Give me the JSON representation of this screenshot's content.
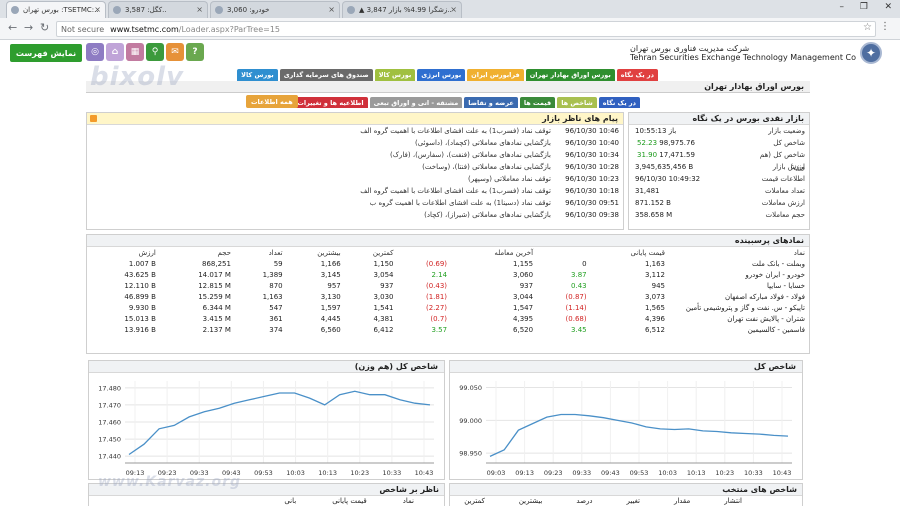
{
  "browser": {
    "tabs": [
      {
        "title": "بورس تهران :TSETMC:..",
        "active": true
      },
      {
        "title": "3,587 :کگل..",
        "active": false
      },
      {
        "title": "3,060 :خودرو",
        "active": false
      },
      {
        "title": "▲ 3,847 زشگرا 4.99% بازار..",
        "active": false
      }
    ],
    "url_secure": "Not secure",
    "url_host": "www.tsetmc.com",
    "url_path": "/Loader.aspx?ParTree=15"
  },
  "header": {
    "brand_fa": "شرکت مدیریت فناوری بورس تهران",
    "brand_en": "Tehran Securities Exchange Technology Management Co",
    "show_list": "نمایش فهرست",
    "tool_icons": [
      {
        "name": "help-icon",
        "glyph": "?",
        "color": "#6aa84f"
      },
      {
        "name": "message-icon",
        "glyph": "✉",
        "color": "#e69138"
      },
      {
        "name": "search-icon",
        "glyph": "⚲",
        "color": "#3c9a3c"
      },
      {
        "name": "calendar-icon",
        "glyph": "▦",
        "color": "#c27ba0"
      },
      {
        "name": "home-icon",
        "glyph": "⌂",
        "color": "#c0a4d8"
      },
      {
        "name": "compass-icon",
        "glyph": "◎",
        "color": "#8e7cc3"
      }
    ]
  },
  "mainnav": [
    {
      "label": "در یک نگاه",
      "color": "#e04040"
    },
    {
      "label": "بورس اوراق بهادار تهران",
      "color": "#2f8f2f"
    },
    {
      "label": "فرابورس ایران",
      "color": "#f0b030"
    },
    {
      "label": "بورس انرژی",
      "color": "#2f6fd0"
    },
    {
      "label": "بورس کالا",
      "color": "#a0c040"
    },
    {
      "label": "صندوق های سرمایه گذاری",
      "color": "#7a7a7a"
    },
    {
      "label": "بورس کالا",
      "color": "#2f8fd0"
    }
  ],
  "titlebar": "بورس اوراق بهادار تهران",
  "subnav": [
    {
      "label": "در یک نگاه",
      "color": "#3060c0"
    },
    {
      "label": "شاخص ها",
      "color": "#a8c050"
    },
    {
      "label": "قیمت ها",
      "color": "#3a8a3a"
    },
    {
      "label": "عرضه و تقاضا",
      "color": "#3a6ab0"
    },
    {
      "label": "مشتقه - اتی و اوراق تبعی",
      "color": "#9a9a9a"
    },
    {
      "label": "اطلاعیه ها و تغییرات",
      "color": "#d0303a"
    }
  ],
  "allinfo": "همه اطلاعات",
  "market": {
    "title": "بازار نقدی بورس در یک نگاه",
    "rows": [
      {
        "k": "وضعیت بازار",
        "v": "باز",
        "time": "10:55:13",
        "chg": ""
      },
      {
        "k": "شاخص کل",
        "v": "98,975.76",
        "chg": "52.23"
      },
      {
        "k": "شاخص کل (هم وزن)",
        "v": "17,471.59",
        "chg": "31.90"
      },
      {
        "k": "ارزش بازار",
        "v": "3,945,635,456 B",
        "chg": ""
      },
      {
        "k": "اطلاعات قیمت",
        "v": "96/10/30 10:49:32",
        "chg": ""
      },
      {
        "k": "تعداد معاملات",
        "v": "31,481",
        "chg": ""
      },
      {
        "k": "ارزش معاملات",
        "v": "871.152 B",
        "chg": ""
      },
      {
        "k": "حجم معاملات",
        "v": "358.658 M",
        "chg": ""
      }
    ]
  },
  "messages": {
    "title": "پیام های ناظر بازار",
    "rows": [
      {
        "d": "96/10/30 10:46",
        "t": "توقف نماد (فسرب1) به علت افشای اطلاعات با اهمیت گروه الف"
      },
      {
        "d": "96/10/30 10:40",
        "t": "بازگشایی نمادهای معاملاتی (کچماد)، (داسوئی)"
      },
      {
        "d": "96/10/30 10:34",
        "t": "بازگشایی نمادهای معاملاتی (فنفت)، (سفارس)، (فارک)"
      },
      {
        "d": "96/10/30 10:28",
        "t": "بازگشایی نمادهای معاملاتی (فنتا)، (وساخت)"
      },
      {
        "d": "96/10/30 10:23",
        "t": "توقف نماد معاملاتی (وسپهر)"
      },
      {
        "d": "96/10/30 10:18",
        "t": "توقف نماد (فسرب1) به علت افشای اطلاعات با اهمیت گروه الف"
      },
      {
        "d": "96/10/30 09:51",
        "t": "توقف نماد (دسینا1) به علت افشای اطلاعات با اهمیت گروه ب"
      },
      {
        "d": "96/10/30 09:38",
        "t": "بازگشایی نمادهای معاملاتی (شیراز)، (کچاد)"
      }
    ]
  },
  "influential": {
    "title": "نمادهای پرسبینده",
    "headers": [
      "نماد",
      "قیمت پایانی",
      "",
      "آخرین معامله",
      "",
      "کمترین",
      "بیشترین",
      "تعداد",
      "حجم",
      "ارزش"
    ],
    "rows": [
      {
        "name": "وبملت - بانک ملت",
        "close": "1,163",
        "close_chg": "0",
        "close_chg_cls": "",
        "last": "1,155",
        "last_chg": "(0.69)",
        "last_chg_cls": "neg",
        "low": "1,150",
        "high": "1,166",
        "count": "59",
        "vol": "868,251",
        "value": "1.007 B"
      },
      {
        "name": "خودرو - ایران خودرو",
        "close": "3,112",
        "close_chg": "3.87",
        "close_chg_cls": "pos",
        "last": "3,060",
        "last_chg": "2.14",
        "last_chg_cls": "pos",
        "low": "3,054",
        "high": "3,145",
        "count": "1,389",
        "vol": "14.017 M",
        "value": "43.625 B"
      },
      {
        "name": "خسایا - سایپا",
        "close": "945",
        "close_chg": "0.43",
        "close_chg_cls": "pos",
        "last": "937",
        "last_chg": "(0.43)",
        "last_chg_cls": "neg",
        "low": "937",
        "high": "957",
        "count": "870",
        "vol": "12.815 M",
        "value": "12.110 B"
      },
      {
        "name": "فولاد - فولاد مبارکه اصفهان",
        "close": "3,073",
        "close_chg": "(0.87)",
        "close_chg_cls": "neg",
        "last": "3,044",
        "last_chg": "(1.81)",
        "last_chg_cls": "neg",
        "low": "3,030",
        "high": "3,130",
        "count": "1,163",
        "vol": "15.259 M",
        "value": "46.899 B"
      },
      {
        "name": "تاپیکو - س. نفت و گاز و پتروشیمی تأمین",
        "close": "1,565",
        "close_chg": "(1.14)",
        "close_chg_cls": "neg",
        "last": "1,547",
        "last_chg": "(2.27)",
        "last_chg_cls": "neg",
        "low": "1,541",
        "high": "1,597",
        "count": "547",
        "vol": "6.344 M",
        "value": "9.930 B"
      },
      {
        "name": "شتران - پالایش نفت تهران",
        "close": "4,396",
        "close_chg": "(0.68)",
        "close_chg_cls": "neg",
        "last": "4,395",
        "last_chg": "(0.7)",
        "last_chg_cls": "neg",
        "low": "4,381",
        "high": "4,445",
        "count": "361",
        "vol": "3.415 M",
        "value": "15.013 B"
      },
      {
        "name": "فاسمین - کالسیمین",
        "close": "6,512",
        "close_chg": "3.45",
        "close_chg_cls": "pos",
        "last": "6,520",
        "last_chg": "3.57",
        "last_chg_cls": "pos",
        "low": "6,412",
        "high": "6,560",
        "count": "374",
        "vol": "2.137 M",
        "value": "13.916 B"
      }
    ]
  },
  "chart_data": [
    {
      "type": "line",
      "title": "شاخص کل",
      "x": [
        "09:03",
        "09:13",
        "09:23",
        "09:33",
        "09:43",
        "09:53",
        "10:03",
        "10:13",
        "10:23",
        "10:33",
        "10:43"
      ],
      "series": [
        {
          "values": [
            98945,
            98955,
            98985,
            98995,
            99005,
            99009,
            99009,
            99007,
            99004,
            99000,
            98996,
            98990,
            98987,
            98986,
            98987,
            98984,
            98983,
            98981,
            98980,
            98979,
            98977,
            98976
          ]
        }
      ],
      "yticks": [
        "98.950",
        "99.000",
        "99.050"
      ],
      "ylim": [
        98935,
        99060
      ],
      "color": "#4a90c8"
    },
    {
      "type": "line",
      "title": "شاخص کل (هم وزن)",
      "x": [
        "09:13",
        "09:23",
        "09:33",
        "09:43",
        "09:53",
        "10:03",
        "10:13",
        "10:23",
        "10:33",
        "10:43"
      ],
      "series": [
        {
          "values": [
            17441,
            17447,
            17456,
            17458,
            17463,
            17466,
            17468,
            17471,
            17473,
            17475,
            17477,
            17477,
            17474,
            17470,
            17476,
            17478,
            17476,
            17476,
            17473,
            17471,
            17470
          ]
        }
      ],
      "yticks": [
        "17.440",
        "17.450",
        "17.460",
        "17.470",
        "17.480"
      ],
      "ylim": [
        17436,
        17484
      ],
      "color": "#4a90c8"
    }
  ],
  "bottom": {
    "left_title": "ناظر بر شاخص",
    "left_headers": [
      "نماد",
      "قیمت پایانی",
      "بانی"
    ],
    "right_title": "شاخص های منتخب",
    "right_headers": [
      "انتشار",
      "مقدار",
      "تغییر",
      "درصد",
      "بیشترین",
      "کمترین"
    ]
  },
  "watermark": "bixolv",
  "watermark2": "www.Karvaz.org"
}
